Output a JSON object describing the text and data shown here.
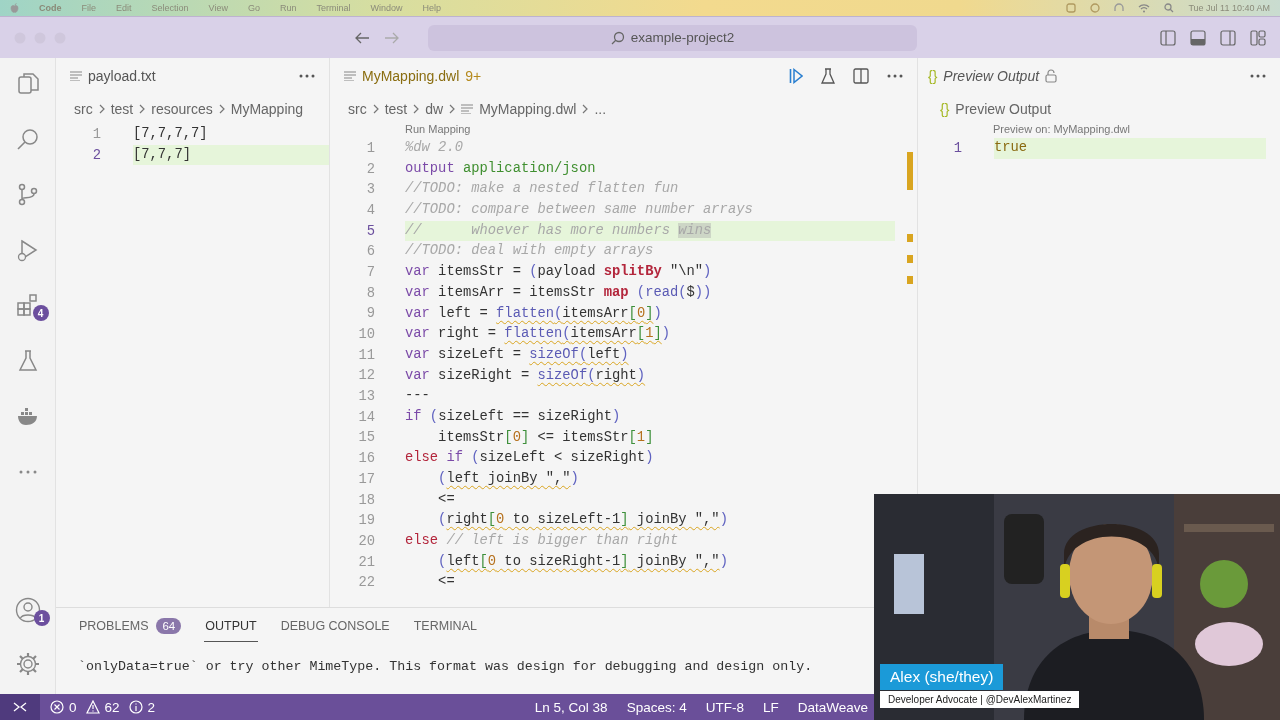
{
  "menubar": {
    "app": "Code",
    "items": [
      "File",
      "Edit",
      "Selection",
      "View",
      "Go",
      "Run",
      "Terminal",
      "Window",
      "Help"
    ],
    "clock": "Tue Jul 11  10:40 AM"
  },
  "titlebar": {
    "search": "example-project2"
  },
  "activity_bar": {
    "items": [
      {
        "kind": "files"
      },
      {
        "kind": "search"
      },
      {
        "kind": "source-control"
      },
      {
        "kind": "run"
      },
      {
        "kind": "extensions",
        "badge": "4"
      },
      {
        "kind": "testing"
      },
      {
        "kind": "docker"
      },
      {
        "kind": "more"
      }
    ],
    "account_badge": "1"
  },
  "left_editor": {
    "tab": "payload.txt",
    "breadcrumbs": [
      "src",
      "test",
      "resources",
      "MyMapping"
    ],
    "lines": [
      {
        "number": "1",
        "text": "[7,7,7,7]",
        "current": false
      },
      {
        "number": "2",
        "text": "[7,7,7]",
        "current": true
      }
    ]
  },
  "main_editor": {
    "tab": "MyMapping.dwl",
    "problems": "9+",
    "breadcrumbs": [
      "src",
      "test",
      "dw",
      "MyMapping.dwl",
      "..."
    ],
    "codelens": "Run Mapping",
    "lines": [
      {
        "number": "1",
        "current": false,
        "tokens": [
          {
            "kind": "comment",
            "text": "%dw 2.0",
            "warning": false
          }
        ]
      },
      {
        "number": "2",
        "current": false,
        "tokens": [
          {
            "kind": "keyword",
            "text": "output ",
            "warning": false
          },
          {
            "kind": "mime",
            "text": "application/json",
            "warning": false
          }
        ]
      },
      {
        "number": "3",
        "current": false,
        "tokens": [
          {
            "kind": "comment",
            "text": "//TODO: make a nested flatten fun",
            "warning": false
          }
        ]
      },
      {
        "number": "4",
        "current": false,
        "tokens": [
          {
            "kind": "comment",
            "text": "//TODO: compare between same number arrays",
            "warning": false
          }
        ]
      },
      {
        "number": "5",
        "current": true,
        "tokens": [
          {
            "kind": "comment",
            "text": "//      whoever has more numbers ",
            "warning": false
          },
          {
            "kind": "comment-match",
            "text": "wins",
            "warning": false
          }
        ]
      },
      {
        "number": "6",
        "current": false,
        "tokens": [
          {
            "kind": "comment",
            "text": "//TODO: deal with empty arrays",
            "warning": false
          }
        ]
      },
      {
        "number": "7",
        "current": false,
        "tokens": [
          {
            "kind": "keyword",
            "text": "var",
            "warning": false
          },
          {
            "kind": "plain",
            "text": " itemsStr = ",
            "warning": false
          },
          {
            "kind": "paren",
            "text": "(",
            "warning": false
          },
          {
            "kind": "plain",
            "text": "payload ",
            "warning": false
          },
          {
            "kind": "operator",
            "text": "splitBy",
            "warning": false
          },
          {
            "kind": "plain",
            "text": " \"\\n\"",
            "warning": false
          },
          {
            "kind": "paren",
            "text": ")",
            "warning": false
          }
        ]
      },
      {
        "number": "8",
        "current": false,
        "tokens": [
          {
            "kind": "keyword",
            "text": "var",
            "warning": false
          },
          {
            "kind": "plain",
            "text": " itemsArr = itemsStr ",
            "warning": false
          },
          {
            "kind": "operator",
            "text": "map ",
            "warning": false
          },
          {
            "kind": "paren",
            "text": "(",
            "warning": false
          },
          {
            "kind": "function",
            "text": "read",
            "warning": false
          },
          {
            "kind": "paren",
            "text": "(",
            "warning": false
          },
          {
            "kind": "plain",
            "text": "$",
            "warning": false
          },
          {
            "kind": "paren",
            "text": "))",
            "warning": false
          }
        ]
      },
      {
        "number": "9",
        "current": false,
        "tokens": [
          {
            "kind": "keyword",
            "text": "var",
            "warning": false
          },
          {
            "kind": "plain",
            "text": " left = ",
            "warning": false
          },
          {
            "kind": "function",
            "text": "flatten",
            "warning": true
          },
          {
            "kind": "paren",
            "text": "(",
            "warning": true
          },
          {
            "kind": "plain",
            "text": "itemsArr",
            "warning": true
          },
          {
            "kind": "bracket",
            "text": "[",
            "warning": true
          },
          {
            "kind": "number",
            "text": "0",
            "warning": true
          },
          {
            "kind": "bracket",
            "text": "]",
            "warning": true
          },
          {
            "kind": "paren",
            "text": ")",
            "warning": false
          }
        ]
      },
      {
        "number": "10",
        "current": false,
        "tokens": [
          {
            "kind": "keyword",
            "text": "var",
            "warning": false
          },
          {
            "kind": "plain",
            "text": " right = ",
            "warning": false
          },
          {
            "kind": "function",
            "text": "flatten",
            "warning": true
          },
          {
            "kind": "paren",
            "text": "(",
            "warning": true
          },
          {
            "kind": "plain",
            "text": "itemsArr",
            "warning": true
          },
          {
            "kind": "bracket",
            "text": "[",
            "warning": true
          },
          {
            "kind": "number",
            "text": "1",
            "warning": true
          },
          {
            "kind": "bracket",
            "text": "]",
            "warning": true
          },
          {
            "kind": "paren",
            "text": ")",
            "warning": false
          }
        ]
      },
      {
        "number": "11",
        "current": false,
        "tokens": [
          {
            "kind": "keyword",
            "text": "var",
            "warning": false
          },
          {
            "kind": "plain",
            "text": " sizeLeft = ",
            "warning": false
          },
          {
            "kind": "function",
            "text": "sizeOf",
            "warning": true
          },
          {
            "kind": "paren",
            "text": "(",
            "warning": true
          },
          {
            "kind": "plain",
            "text": "left",
            "warning": true
          },
          {
            "kind": "paren",
            "text": ")",
            "warning": true
          }
        ]
      },
      {
        "number": "12",
        "current": false,
        "tokens": [
          {
            "kind": "keyword",
            "text": "var",
            "warning": false
          },
          {
            "kind": "plain",
            "text": " sizeRight = ",
            "warning": false
          },
          {
            "kind": "function",
            "text": "sizeOf",
            "warning": true
          },
          {
            "kind": "paren",
            "text": "(",
            "warning": true
          },
          {
            "kind": "plain",
            "text": "right",
            "warning": true
          },
          {
            "kind": "paren",
            "text": ")",
            "warning": true
          }
        ]
      },
      {
        "number": "13",
        "current": false,
        "tokens": [
          {
            "kind": "plain",
            "text": "---",
            "warning": false
          }
        ]
      },
      {
        "number": "14",
        "current": false,
        "tokens": [
          {
            "kind": "keyword",
            "text": "if ",
            "warning": false
          },
          {
            "kind": "paren",
            "text": "(",
            "warning": false
          },
          {
            "kind": "plain",
            "text": "sizeLeft == sizeRight",
            "warning": false
          },
          {
            "kind": "paren",
            "text": ")",
            "warning": false
          }
        ]
      },
      {
        "number": "15",
        "current": false,
        "tokens": [
          {
            "kind": "plain",
            "text": "    itemsStr",
            "warning": false
          },
          {
            "kind": "bracket",
            "text": "[",
            "warning": false
          },
          {
            "kind": "number",
            "text": "0",
            "warning": false
          },
          {
            "kind": "bracket",
            "text": "]",
            "warning": false
          },
          {
            "kind": "plain",
            "text": " <= itemsStr",
            "warning": false
          },
          {
            "kind": "bracket",
            "text": "[",
            "warning": false
          },
          {
            "kind": "number",
            "text": "1",
            "warning": false
          },
          {
            "kind": "bracket",
            "text": "]",
            "warning": false
          }
        ]
      },
      {
        "number": "16",
        "current": false,
        "tokens": [
          {
            "kind": "control",
            "text": "else ",
            "warning": false
          },
          {
            "kind": "keyword",
            "text": "if ",
            "warning": false
          },
          {
            "kind": "paren",
            "text": "(",
            "warning": false
          },
          {
            "kind": "plain",
            "text": "sizeLeft < sizeRight",
            "warning": false
          },
          {
            "kind": "paren",
            "text": ")",
            "warning": false
          }
        ]
      },
      {
        "number": "17",
        "current": false,
        "tokens": [
          {
            "kind": "paren",
            "text": "    (",
            "warning": false
          },
          {
            "kind": "plain",
            "text": "left joinBy \",\"",
            "warning": true
          },
          {
            "kind": "paren",
            "text": ")",
            "warning": false
          }
        ]
      },
      {
        "number": "18",
        "current": false,
        "tokens": [
          {
            "kind": "plain",
            "text": "    <=",
            "warning": false
          }
        ]
      },
      {
        "number": "19",
        "current": false,
        "tokens": [
          {
            "kind": "paren",
            "text": "    (",
            "warning": false
          },
          {
            "kind": "plain",
            "text": "right",
            "warning": true
          },
          {
            "kind": "bracket",
            "text": "[",
            "warning": true
          },
          {
            "kind": "number",
            "text": "0",
            "warning": true
          },
          {
            "kind": "plain",
            "text": " to sizeLeft-1",
            "warning": true
          },
          {
            "kind": "bracket",
            "text": "]",
            "warning": true
          },
          {
            "kind": "plain",
            "text": " joinBy \",\"",
            "warning": true
          },
          {
            "kind": "paren",
            "text": ")",
            "warning": false
          }
        ]
      },
      {
        "number": "20",
        "current": false,
        "tokens": [
          {
            "kind": "control",
            "text": "else ",
            "warning": false
          },
          {
            "kind": "comment",
            "text": "// left is bigger than right",
            "warning": false
          }
        ]
      },
      {
        "number": "21",
        "current": false,
        "tokens": [
          {
            "kind": "paren",
            "text": "    (",
            "warning": false
          },
          {
            "kind": "plain",
            "text": "left",
            "warning": true
          },
          {
            "kind": "bracket",
            "text": "[",
            "warning": true
          },
          {
            "kind": "number",
            "text": "0",
            "warning": true
          },
          {
            "kind": "plain",
            "text": " to sizeRight-1",
            "warning": true
          },
          {
            "kind": "bracket",
            "text": "]",
            "warning": true
          },
          {
            "kind": "plain",
            "text": " joinBy \",\"",
            "warning": true
          },
          {
            "kind": "paren",
            "text": ")",
            "warning": false
          }
        ]
      },
      {
        "number": "22",
        "current": false,
        "tokens": [
          {
            "kind": "plain",
            "text": "    <=",
            "warning": false
          }
        ]
      }
    ]
  },
  "preview": {
    "braces": "{}",
    "tab": "Preview Output",
    "breadcrumb": "Preview Output",
    "caption": "Preview on: MyMapping.dwl",
    "lines": [
      {
        "number": "1",
        "text": "true",
        "current": true
      }
    ]
  },
  "panel": {
    "tabs": [
      {
        "label": "PROBLEMS",
        "badge": "64",
        "selected": false
      },
      {
        "label": "OUTPUT",
        "selected": true
      },
      {
        "label": "DEBUG CONSOLE",
        "selected": false
      },
      {
        "label": "TERMINAL",
        "selected": false
      }
    ],
    "output": "`onlyData=true` or try other MimeType. This format was design for debugging and design only."
  },
  "status_bar": {
    "errors": "0",
    "warnings": "62",
    "infos": "2",
    "items": [
      "Ln 5, Col 38",
      "Spaces: 4",
      "UTF-8",
      "LF",
      "DataWeave"
    ]
  },
  "webcam": {
    "kind": "picture",
    "name": "Alex (she/they)",
    "subtitle": "Developer Advocate | @DevAlexMartinez"
  }
}
